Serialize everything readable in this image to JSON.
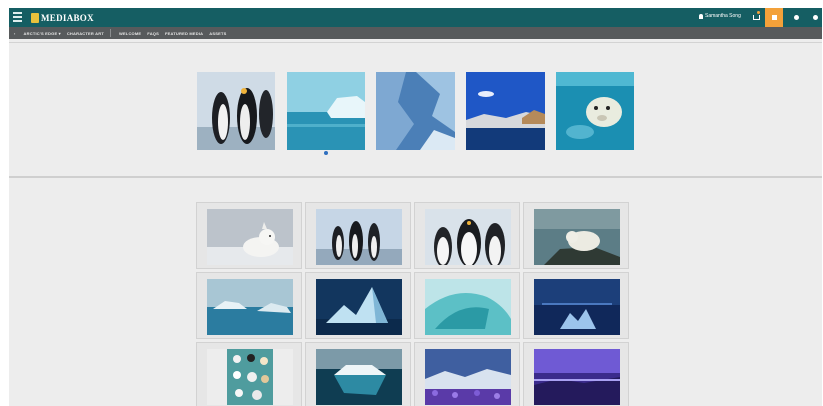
{
  "app": {
    "logo_text": "MEDIABOX"
  },
  "header": {
    "user_name": "Samantha Song"
  },
  "nav": {
    "items": [
      "ARCTIC'S EDGE ▾",
      "CHARACTER ART",
      "WELCOME",
      "FAQS",
      "FEATURED MEDIA",
      "ASSETS"
    ]
  },
  "carousel": {
    "items": [
      {
        "subject": "penguins"
      },
      {
        "subject": "iceberg-sea"
      },
      {
        "subject": "glacier-wall"
      },
      {
        "subject": "coast-blue-sky"
      },
      {
        "subject": "swimming-polar-bear"
      }
    ],
    "active_page": 1
  },
  "gallery": {
    "items": [
      {
        "subject": "arctic-fox"
      },
      {
        "subject": "penguins-group"
      },
      {
        "subject": "penguins-closeup"
      },
      {
        "subject": "polar-bear-on-rock"
      },
      {
        "subject": "ice-floe-water"
      },
      {
        "subject": "blue-iceberg-peak"
      },
      {
        "subject": "ice-wave"
      },
      {
        "subject": "night-iceberg"
      },
      {
        "subject": "character-art-sheet"
      },
      {
        "subject": "iceberg-underwater"
      },
      {
        "subject": "purple-flowers-ice"
      },
      {
        "subject": "violet-sky-ice"
      }
    ]
  },
  "colors": {
    "topbar": "#155e63",
    "navbar": "#575a5c",
    "accent": "#f3a13a",
    "page_bg": "#ededed"
  },
  "icons": [
    "menu-icon",
    "user-icon",
    "cart-icon",
    "grid-icon",
    "settings-icon",
    "logout-icon",
    "chevron-left-icon"
  ]
}
